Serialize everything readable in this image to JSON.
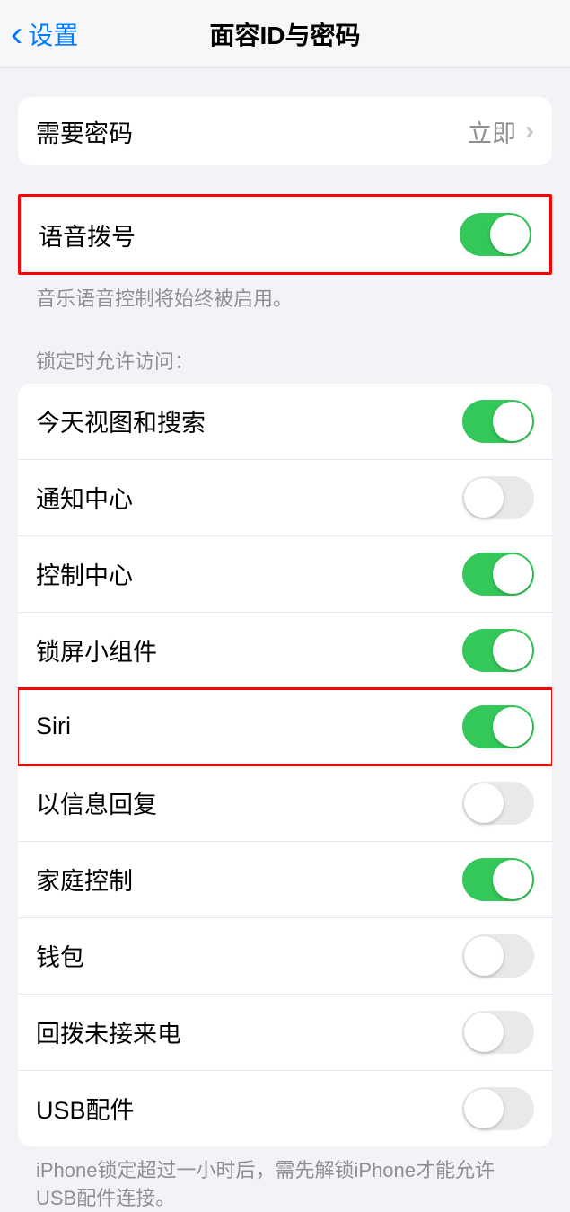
{
  "header": {
    "back_label": "设置",
    "title": "面容ID与密码"
  },
  "require_passcode": {
    "label": "需要密码",
    "value": "立即"
  },
  "voice_dial": {
    "label": "语音拨号",
    "state": "on",
    "footer": "音乐语音控制将始终被启用。"
  },
  "lock_section": {
    "header": "锁定时允许访问：",
    "items": [
      {
        "label": "今天视图和搜索",
        "state": "on"
      },
      {
        "label": "通知中心",
        "state": "off"
      },
      {
        "label": "控制中心",
        "state": "on"
      },
      {
        "label": "锁屏小组件",
        "state": "on"
      },
      {
        "label": "Siri",
        "state": "on"
      },
      {
        "label": "以信息回复",
        "state": "off"
      },
      {
        "label": "家庭控制",
        "state": "on"
      },
      {
        "label": "钱包",
        "state": "off"
      },
      {
        "label": "回拨未接来电",
        "state": "off"
      },
      {
        "label": "USB配件",
        "state": "off"
      }
    ],
    "footer": "iPhone锁定超过一小时后，需先解锁iPhone才能允许USB配件连接。"
  }
}
